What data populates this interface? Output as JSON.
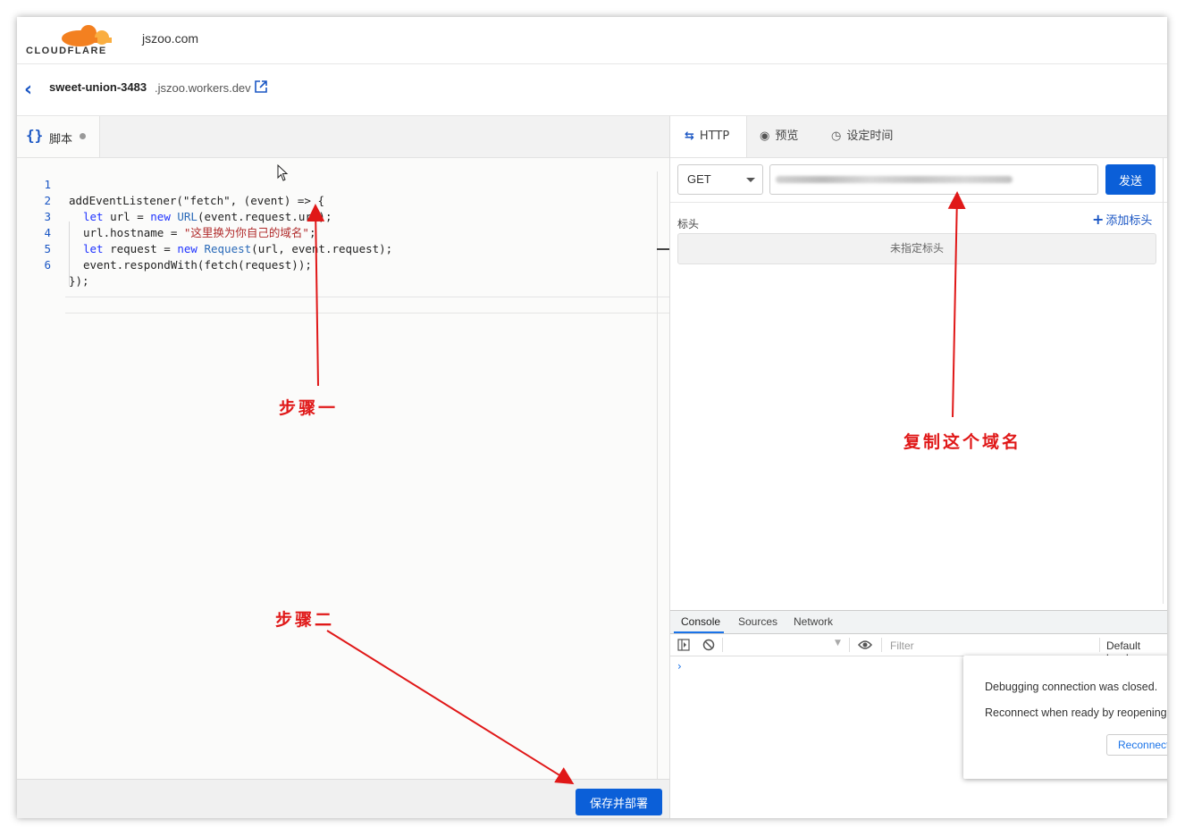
{
  "app": {
    "logo_text": "CLOUDFLARE",
    "domain": "jszoo.com"
  },
  "worker": {
    "name": "sweet-union-3483",
    "suffix": ".jszoo.workers.dev"
  },
  "editor": {
    "tab_label": "脚本",
    "line_numbers": [
      "1",
      "2",
      "3",
      "4",
      "5",
      "6"
    ],
    "code": {
      "l1": "addEventListener(\"fetch\", (event) => {",
      "l2_kw": "let",
      "l2_a": " url = ",
      "l2_new": "new",
      "l2_fn": " URL",
      "l2_b": "(event.request.url);",
      "l3_a": "url.hostname = ",
      "l3_str": "\"这里换为你自己的域名\"",
      "l3_b": ";",
      "l4_kw": "let",
      "l4_a": " request = ",
      "l4_new": "new",
      "l4_fn": " Request",
      "l4_b": "(url, event.request);",
      "l5": "event.respondWith(fetch(request));",
      "l6": "});"
    },
    "save_label": "保存并部署"
  },
  "request": {
    "tabs": [
      "HTTP",
      "预览",
      "设定时间"
    ],
    "method": "GET",
    "send_label": "发送",
    "headers_label": "标头",
    "add_header_label": "添加标头",
    "no_headers_label": "未指定标头"
  },
  "devtools": {
    "tabs": [
      "Console",
      "Sources",
      "Network"
    ],
    "filter_placeholder": "Filter",
    "levels": "Default levels",
    "prompt": "›",
    "dialog_line1": "Debugging connection was closed.",
    "dialog_line2": "Reconnect when ready by reopening",
    "reconnect_label": "Reconnect"
  },
  "annotations": {
    "step1": "步骤一",
    "step2": "步骤二",
    "copy_domain": "复制这个域名"
  },
  "colors": {
    "accent": "#0b5fd8",
    "annotation": "#e01818",
    "logo_orange": "#f38020"
  }
}
